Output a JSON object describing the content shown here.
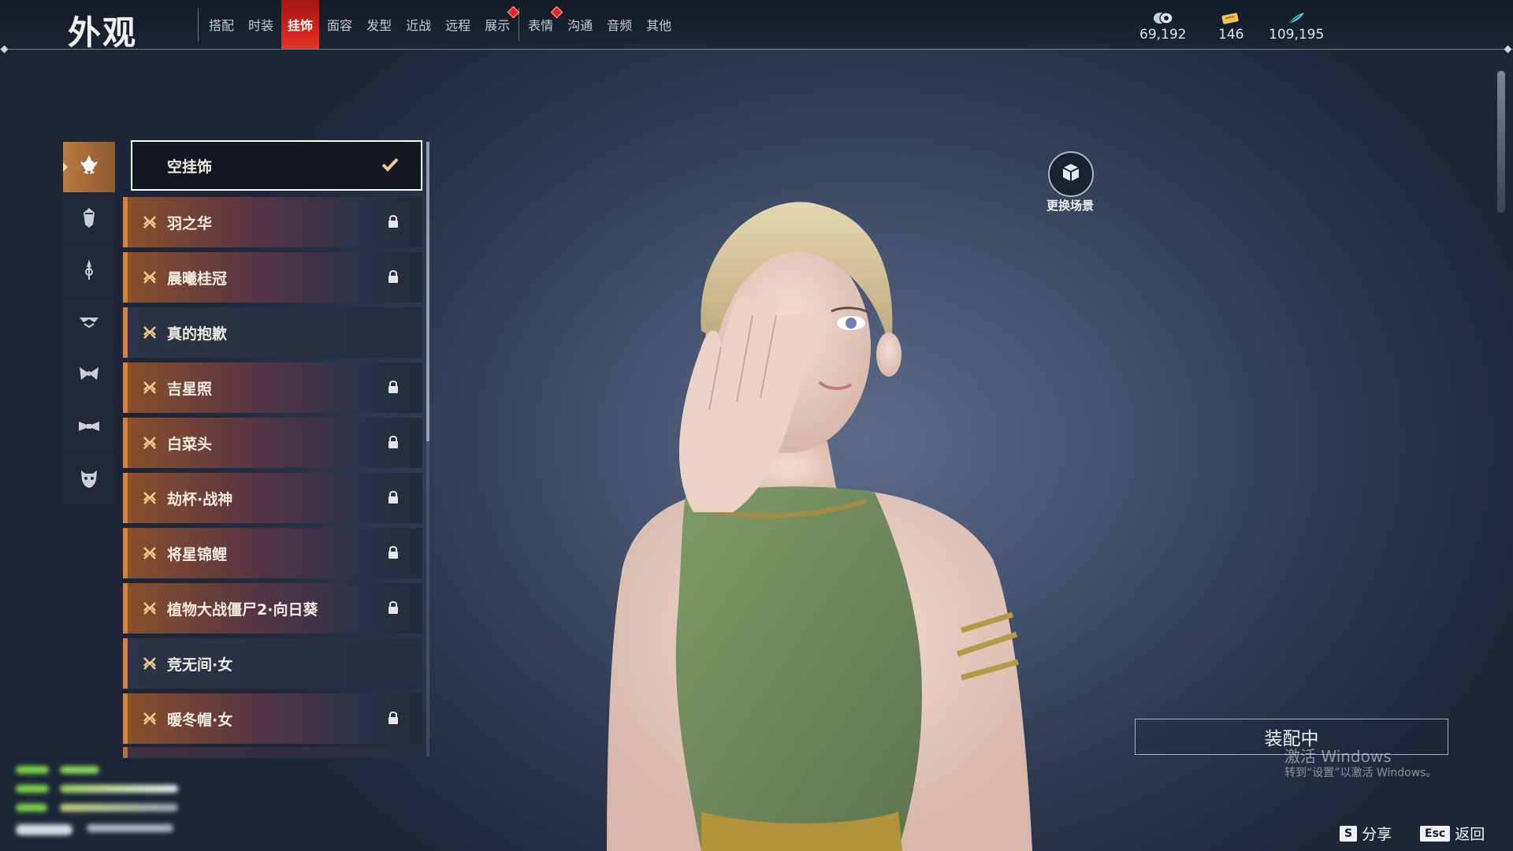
{
  "header": {
    "title": "外观",
    "tabs": [
      {
        "label": "搭配",
        "active": false,
        "badge": false
      },
      {
        "label": "时装",
        "active": false,
        "badge": false
      },
      {
        "label": "挂饰",
        "active": true,
        "badge": false
      },
      {
        "label": "面容",
        "active": false,
        "badge": false
      },
      {
        "label": "发型",
        "active": false,
        "badge": false
      },
      {
        "label": "近战",
        "active": false,
        "badge": false
      },
      {
        "label": "远程",
        "active": false,
        "badge": false
      },
      {
        "label": "展示",
        "active": false,
        "badge": true
      },
      {
        "label": "表情",
        "active": false,
        "badge": true
      },
      {
        "label": "沟通",
        "active": false,
        "badge": false
      },
      {
        "label": "音频",
        "active": false,
        "badge": false
      },
      {
        "label": "其他",
        "active": false,
        "badge": false
      }
    ],
    "currencies": [
      {
        "icon": "coin-icon",
        "value": "69,192"
      },
      {
        "icon": "ticket-icon",
        "value": "146"
      },
      {
        "icon": "feather-icon",
        "value": "109,195"
      }
    ]
  },
  "categories": [
    {
      "icon": "head-ornament-icon",
      "active": true
    },
    {
      "icon": "face-ornament-icon",
      "active": false
    },
    {
      "icon": "back-ornament-icon",
      "active": false
    },
    {
      "icon": "waist-ornament-icon",
      "active": false
    },
    {
      "icon": "wing-ornament-icon",
      "active": false
    },
    {
      "icon": "tail-ornament-icon",
      "active": false
    },
    {
      "icon": "mask-ornament-icon",
      "active": false
    }
  ],
  "items": [
    {
      "name": "空挂饰",
      "selected": true,
      "locked": false
    },
    {
      "name": "羽之华",
      "selected": false,
      "locked": true
    },
    {
      "name": "晨曦桂冠",
      "selected": false,
      "locked": true
    },
    {
      "name": "真的抱歉",
      "selected": false,
      "locked": false
    },
    {
      "name": "吉星照",
      "selected": false,
      "locked": true
    },
    {
      "name": "白菜头",
      "selected": false,
      "locked": true
    },
    {
      "name": "劫杯·战神",
      "selected": false,
      "locked": true
    },
    {
      "name": "将星锦鲤",
      "selected": false,
      "locked": true
    },
    {
      "name": "植物大战僵尸2·向日葵",
      "selected": false,
      "locked": true
    },
    {
      "name": "竞无间·女",
      "selected": false,
      "locked": false
    },
    {
      "name": "暖冬帽·女",
      "selected": false,
      "locked": true
    }
  ],
  "scene": {
    "label": "更换场景"
  },
  "equip_status": "装配中",
  "watermark": {
    "line1": "激活 Windows",
    "line2": "转到“设置”以激活 Windows。"
  },
  "hints": {
    "share": {
      "key": "S",
      "label": "分享"
    },
    "back": {
      "key": "Esc",
      "label": "返回"
    }
  },
  "colors": {
    "accent_red": "#d6261b",
    "accent_orange": "#d4823f",
    "rare_gold": "#f3c98a"
  }
}
